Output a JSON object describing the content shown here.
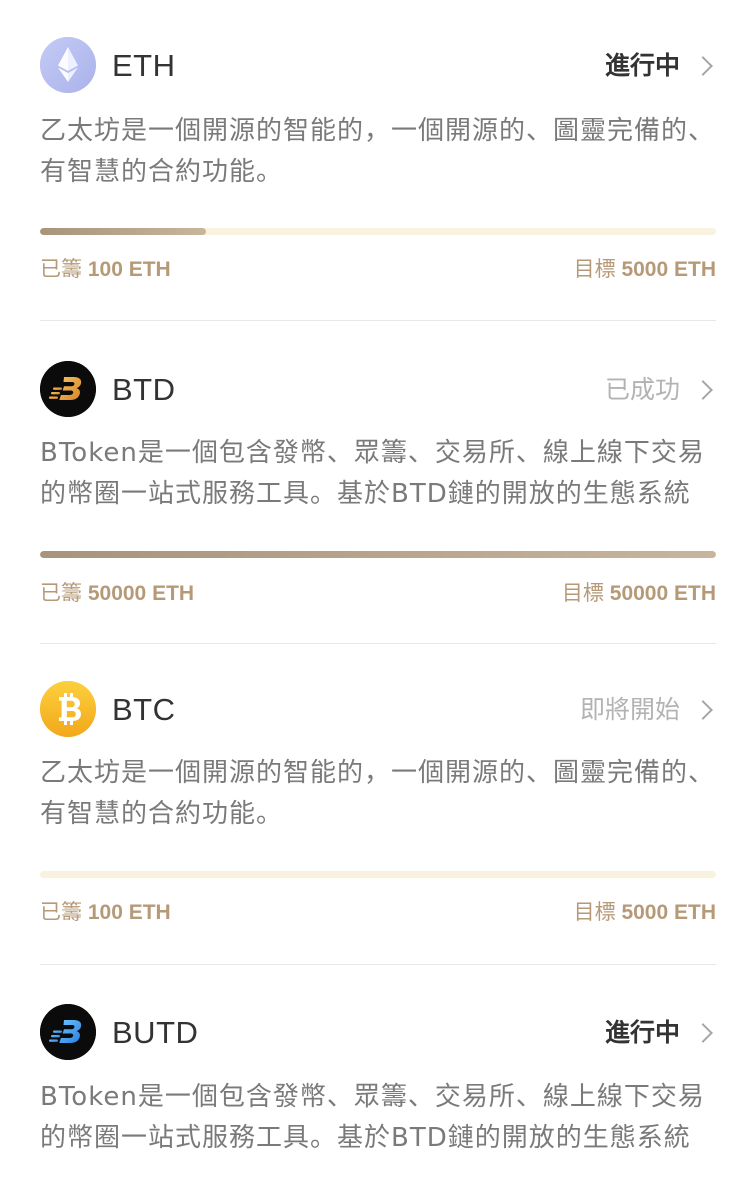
{
  "projects": [
    {
      "symbol": "ETH",
      "logo_icon": "ethereum-icon",
      "status": "進行中",
      "status_style": "active",
      "description": "乙太坊是一個開源的智能的，一個開源的、圖靈完備的、有智慧的合約功能。",
      "progress": 0.245,
      "raised_label": "已籌",
      "raised_value": "100 ETH",
      "target_label": "目標",
      "target_value": "5000 ETH"
    },
    {
      "symbol": "BTD",
      "logo_icon": "btoken-gold-icon",
      "status": "已成功",
      "status_style": "muted",
      "description": "BToken是一個包含發幣、眾籌、交易所、線上線下交易的幣圈一站式服務工具。基於BTD鏈的開放的生態系統",
      "progress": 1.0,
      "raised_label": "已籌",
      "raised_value": "50000 ETH",
      "target_label": "目標",
      "target_value": "50000 ETH"
    },
    {
      "symbol": "BTC",
      "logo_icon": "bitcoin-icon",
      "status": "即將開始",
      "status_style": "muted",
      "description": "乙太坊是一個開源的智能的，一個開源的、圖靈完備的、有智慧的合約功能。",
      "progress": 0.0,
      "raised_label": "已籌",
      "raised_value": "100 ETH",
      "target_label": "目標",
      "target_value": "5000 ETH"
    },
    {
      "symbol": "BUTD",
      "logo_icon": "btoken-blue-icon",
      "status": "進行中",
      "status_style": "active",
      "description": "BToken是一個包含發幣、眾籌、交易所、線上線下交易的幣圈一站式服務工具。基於BTD鏈的開放的生態系統"
    }
  ],
  "colors": {
    "progress_fill": "#b3a08a",
    "progress_track": "#f8f2df",
    "meta_text": "#b69a78",
    "bitcoin": "#f7b928",
    "btoken_gold": "#e8a23a",
    "btoken_blue": "#3aa0f0"
  }
}
